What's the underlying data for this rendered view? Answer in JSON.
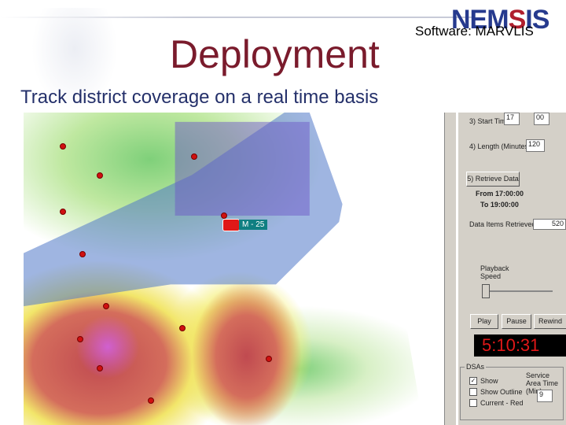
{
  "slide": {
    "title": "Deployment",
    "subtitle": "Track district coverage on a real time basis",
    "software": "Software: MARVLIS",
    "logo_text": "NEMSIS"
  },
  "map": {
    "unit_label": "M - 25"
  },
  "panel": {
    "start_time_label": "3) Start Time",
    "start_hour": "17",
    "start_min": "00",
    "length_label": "4) Length (Minutes)",
    "length_value": "120",
    "retrieve_button": "5) Retrieve Data",
    "from": "From 17:00:00",
    "to": "To 19:00:00",
    "items_label": "Data Items Retrieved",
    "items_value": "520",
    "playback_label": "Playback Speed",
    "play": "Play",
    "pause": "Pause",
    "rewind": "Rewind",
    "clock": "5:10:31",
    "dsas_label": "DSAs",
    "show": "Show",
    "show_outline": "Show Outline",
    "current_red": "Current - Red",
    "service_label": "Service Area Time (Min)",
    "service_value": "9"
  }
}
